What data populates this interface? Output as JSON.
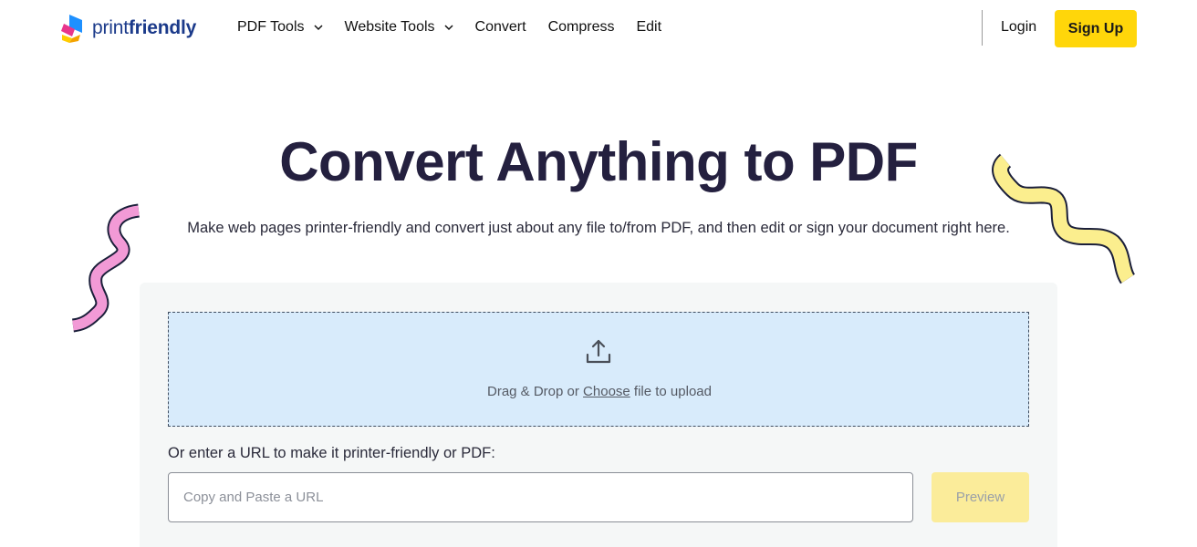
{
  "header": {
    "logo": {
      "text_light": "print",
      "text_bold": "friendly"
    },
    "nav": [
      {
        "label": "PDF Tools",
        "has_dropdown": true
      },
      {
        "label": "Website Tools",
        "has_dropdown": true
      },
      {
        "label": "Convert",
        "has_dropdown": false
      },
      {
        "label": "Compress",
        "has_dropdown": false
      },
      {
        "label": "Edit",
        "has_dropdown": false
      }
    ],
    "login_label": "Login",
    "signup_label": "Sign Up"
  },
  "hero": {
    "title": "Convert Anything to PDF",
    "subtitle": "Make web pages printer-friendly and convert just about any file to/from PDF, and then edit or sign your document right here."
  },
  "converter": {
    "drop_prefix": "Drag & Drop or ",
    "choose_label": "Choose",
    "drop_suffix": " file to upload",
    "url_label": "Or enter a URL to make it printer-friendly or PDF:",
    "url_value": "",
    "url_placeholder": "Copy and Paste a URL",
    "preview_label": "Preview"
  },
  "icons": {
    "logo": "printfriendly-logo-icon",
    "dropdown": "chevron-down-icon",
    "upload": "upload-icon"
  },
  "colors": {
    "accent_yellow": "#ffd60a",
    "title": "#24203f",
    "dropzone_bg": "#d8ebfb",
    "card_bg": "#f5f7f7",
    "preview_disabled": "#fbec9a",
    "squiggle_pink": "#f29ad6",
    "squiggle_yellow": "#fbee8e"
  }
}
